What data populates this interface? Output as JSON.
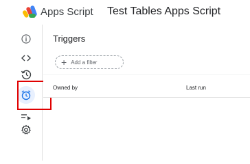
{
  "header": {
    "app_name": "Apps Script",
    "project_name": "Test Tables Apps Script",
    "logo_icon": "apps-script-logo"
  },
  "sidebar": {
    "items": [
      {
        "icon": "info-icon",
        "label": "Overview"
      },
      {
        "icon": "code-icon",
        "label": "Editor"
      },
      {
        "icon": "history-icon",
        "label": "Project history"
      },
      {
        "icon": "alarm-clock-icon",
        "label": "Triggers",
        "active": true
      },
      {
        "icon": "executions-icon",
        "label": "Executions"
      },
      {
        "icon": "gear-icon",
        "label": "Project settings"
      }
    ]
  },
  "main": {
    "title": "Triggers",
    "filter": {
      "plus": "+",
      "label": "Add a filter"
    },
    "columns": [
      "Owned by",
      "Last run"
    ]
  },
  "colors": {
    "accent": "#1a73e8",
    "highlight": "#e00000"
  }
}
